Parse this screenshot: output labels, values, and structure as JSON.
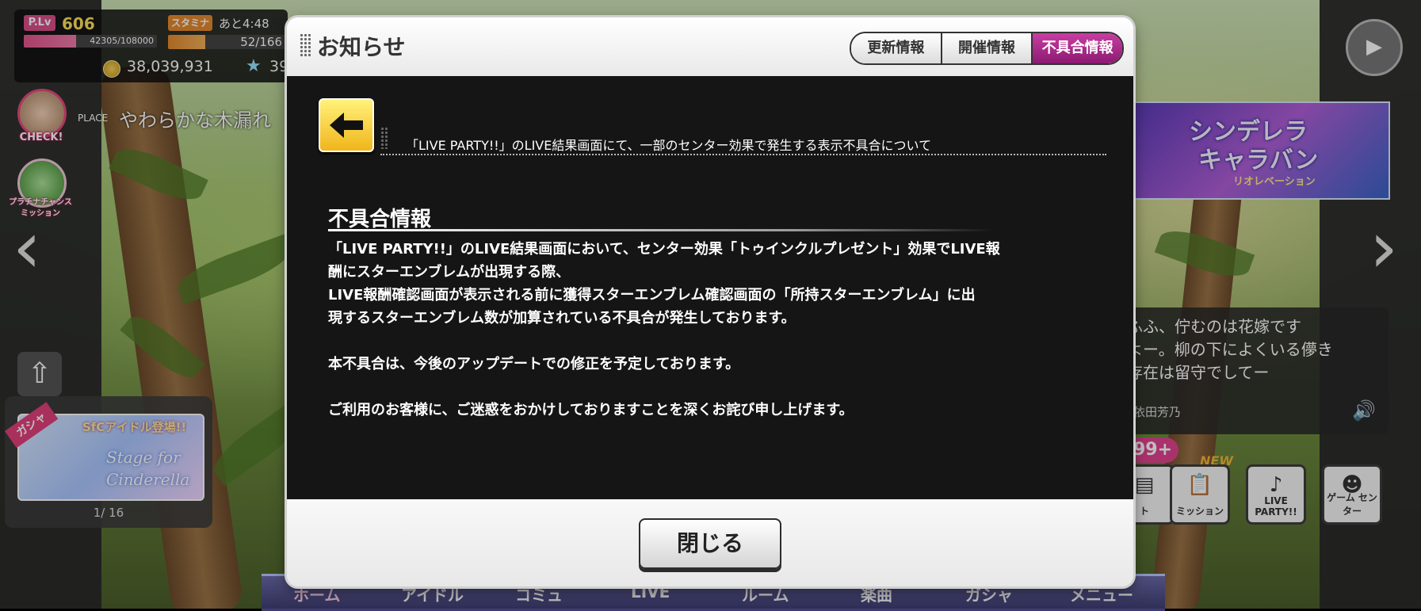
{
  "status": {
    "plv_label": "P.Lv",
    "plv": "606",
    "exp_text": "42305/108000",
    "exp_fraction": 0.39,
    "stamina_label": "スタミナ",
    "stamina_time": "あと4:48",
    "stamina_text": "52/166",
    "stamina_fraction": 0.31,
    "coins": "38,039,931",
    "jewels": "39"
  },
  "left": {
    "check_label": "CHECK!",
    "platinum_label_1": "プラチナチャンス",
    "platinum_label_2": "ミッション",
    "place_tag": "PLACE",
    "place_name": "やわらかな木漏れ",
    "gacha_ribbon": "ガシャ",
    "gacha_head": "SfCアイドル登場!!",
    "gacha_script_1": "Stage for",
    "gacha_script_2": "Cinderella",
    "gacha_page": "1/ 16"
  },
  "right": {
    "event_title_1": "シンデレラ",
    "event_title_2": "キャラバン",
    "event_sub": "リオレベーション",
    "dialog_lines": [
      "ふふ、佇むのは花嫁です",
      "よー。柳の下によくいる儚き",
      "存在は留守でしてー"
    ],
    "speaker": "依田芳乃",
    "badge": "99+",
    "new_tag": "NEW",
    "menu": [
      "ト",
      "ミッション",
      "LIVE PARTY!!",
      "ゲーム センター"
    ]
  },
  "bottom_nav": [
    "ホーム",
    "アイドル",
    "コミュ",
    "LIVE",
    "ルーム",
    "楽曲",
    "ガシャ",
    "メニュー"
  ],
  "modal": {
    "title": "お知らせ",
    "tabs": [
      "更新情報",
      "開催情報",
      "不具合情報"
    ],
    "active_tab": 2,
    "notice_title": "「LIVE PARTY!!」のLIVE結果画面にて、一部のセンター効果で発生する表示不具合について",
    "section_head": "不具合情報",
    "paragraphs": [
      "「LIVE PARTY!!」のLIVE結果画面において、センター効果「トゥインクルプレゼント」効果でLIVE報",
      "酬にスターエンブレムが出現する際、",
      "LIVE報酬確認画面が表示される前に獲得スターエンブレム確認画面の「所持スターエンブレム」に出",
      "現するスターエンブレム数が加算されている不具合が発生しております。",
      "本不具合は、今後のアップデートでの修正を予定しております。",
      "ご利用のお客様に、ご迷惑をおかけしておりますことを深くお詫び申し上げます。"
    ],
    "close_label": "閉じる"
  },
  "colors": {
    "accent_pink": "#d94f8a",
    "tab_active": "#a02585",
    "back_button": "#f1b51b"
  }
}
